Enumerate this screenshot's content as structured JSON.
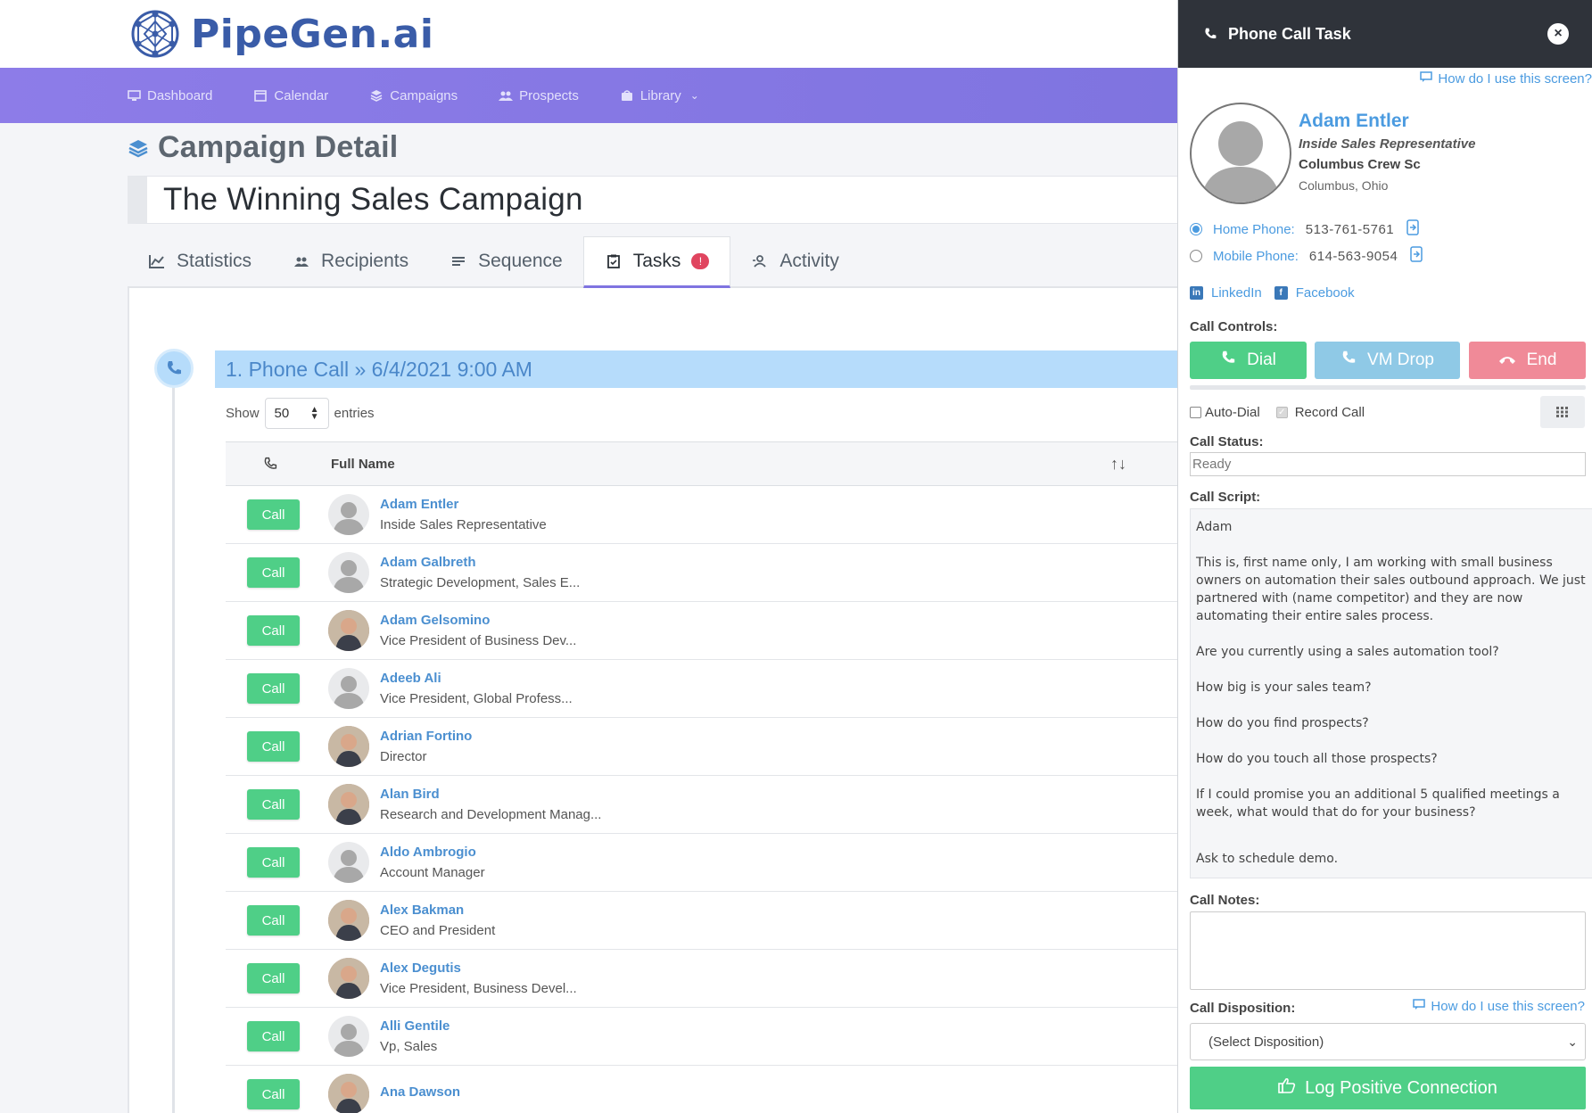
{
  "brand": {
    "name": "PipeGen.ai",
    "color": "#3a5ca8"
  },
  "nav": {
    "items": [
      {
        "label": "Dashboard",
        "icon": "monitor-icon"
      },
      {
        "label": "Calendar",
        "icon": "calendar-icon"
      },
      {
        "label": "Campaigns",
        "icon": "layers-icon"
      },
      {
        "label": "Prospects",
        "icon": "users-icon"
      },
      {
        "label": "Library",
        "icon": "bag-icon"
      }
    ]
  },
  "page": {
    "title": "Campaign Detail",
    "campaign_name": "The Winning Sales Campaign"
  },
  "tabs": [
    {
      "label": "Statistics",
      "icon": "chart-icon"
    },
    {
      "label": "Recipients",
      "icon": "users-icon"
    },
    {
      "label": "Sequence",
      "icon": "list-icon"
    },
    {
      "label": "Tasks",
      "icon": "clipboard-icon",
      "badge": "!"
    },
    {
      "label": "Activity",
      "icon": "user-activity-icon"
    }
  ],
  "step": {
    "title": "1. Phone Call » 6/4/2021 9:00 AM"
  },
  "table": {
    "show_label": "Show",
    "page_size": "50",
    "entries_label": "entries",
    "col_name": "Full Name",
    "call_label": "Call",
    "rows": [
      {
        "name": "Adam Entler",
        "title": "Inside Sales Representative",
        "photo": false
      },
      {
        "name": "Adam Galbreth",
        "title": "Strategic Development, Sales E...",
        "photo": false
      },
      {
        "name": "Adam Gelsomino",
        "title": "Vice President of Business Dev...",
        "photo": true
      },
      {
        "name": "Adeeb Ali",
        "title": "Vice President, Global Profess...",
        "photo": false
      },
      {
        "name": "Adrian Fortino",
        "title": "Director",
        "photo": true
      },
      {
        "name": "Alan Bird",
        "title": "Research and Development Manag...",
        "photo": true
      },
      {
        "name": "Aldo Ambrogio",
        "title": "Account Manager",
        "photo": false
      },
      {
        "name": "Alex Bakman",
        "title": "CEO and President",
        "photo": true
      },
      {
        "name": "Alex Degutis",
        "title": "Vice President, Business Devel...",
        "photo": true
      },
      {
        "name": "Alli Gentile",
        "title": "Vp, Sales",
        "photo": false
      },
      {
        "name": "Ana Dawson",
        "title": "",
        "photo": true
      }
    ]
  },
  "panel": {
    "title": "Phone Call Task",
    "howto": "How do I use this screen?",
    "contact": {
      "name": "Adam Entler",
      "title": "Inside Sales Representative",
      "company": "Columbus Crew Sc",
      "location": "Columbus, Ohio"
    },
    "phones": [
      {
        "label": "Home Phone:",
        "number": "513-761-5761",
        "selected": true
      },
      {
        "label": "Mobile Phone:",
        "number": "614-563-9054",
        "selected": false
      }
    ],
    "social": {
      "linkedin": "LinkedIn",
      "facebook": "Facebook"
    },
    "call_controls_label": "Call Controls:",
    "buttons": {
      "dial": "Dial",
      "vm_drop": "VM Drop",
      "end": "End"
    },
    "auto_dial": "Auto-Dial",
    "record_call": "Record Call",
    "call_status_label": "Call Status:",
    "call_status": "Ready",
    "call_script_label": "Call Script:",
    "script": [
      "Adam",
      "This is, first name only, I am working with small business owners on automation their sales outbound approach. We just partnered with (name competitor) and they are now automating their entire sales process.",
      "Are you currently using a sales automation tool?",
      "How big is your sales team?",
      "How do you find prospects?",
      "How do you touch all those prospects?",
      "If I could promise you an additional 5 qualified meetings a week, what would that do for your business?",
      "Ask to schedule demo."
    ],
    "call_notes_label": "Call Notes:",
    "disposition_label": "Call Disposition:",
    "disposition_howto": "How do I use this screen?",
    "disposition_placeholder": "(Select Disposition)",
    "log_button": "Log Positive Connection"
  },
  "colors": {
    "nav_bg": "#8d7ce8",
    "link": "#4b9be0",
    "call_green": "#4fcf87",
    "vm_blue": "#8fc9e6",
    "end_red": "#f08a98",
    "badge_red": "#e0455f",
    "step_bg": "#b6dcfb"
  }
}
